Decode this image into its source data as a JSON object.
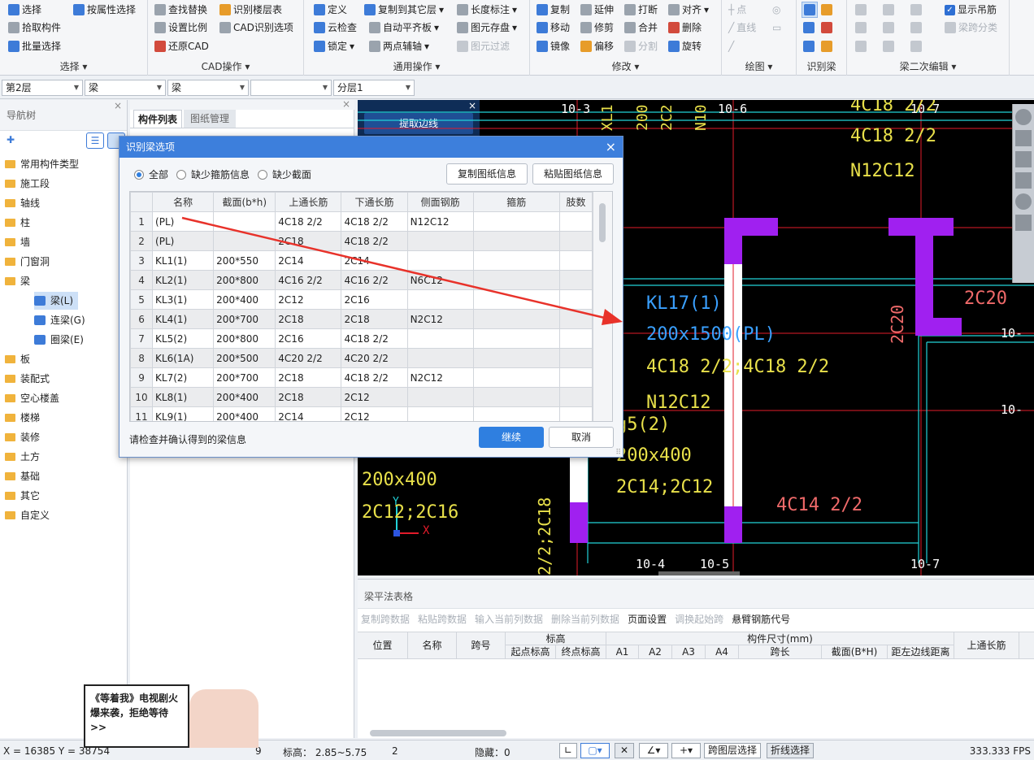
{
  "ribbon": {
    "select": {
      "title": "选择",
      "items": [
        "选择",
        "按属性选择",
        "拾取构件",
        "批量选择"
      ]
    },
    "cad": {
      "title": "CAD操作",
      "items": [
        "查找替换",
        "识别楼层表",
        "设置比例",
        "CAD识别选项",
        "还原CAD"
      ]
    },
    "common": {
      "title": "通用操作",
      "items": [
        "定义",
        "复制到其它层",
        "长度标注",
        "云检查",
        "自动平齐板",
        "图元存盘",
        "锁定",
        "两点辅轴",
        "图元过滤"
      ]
    },
    "modify": {
      "title": "修改",
      "items": [
        "复制",
        "延伸",
        "打断",
        "对齐",
        "移动",
        "修剪",
        "合并",
        "删除",
        "镜像",
        "偏移",
        "分割",
        "旋转"
      ]
    },
    "draw": {
      "title": "绘图",
      "items": [
        "点",
        "直线"
      ]
    },
    "recognize": {
      "title": "识别梁"
    },
    "beam2": {
      "title": "梁二次编辑",
      "show_hanger_label": "显示吊筋",
      "span_label": "梁跨分类"
    }
  },
  "combos": {
    "floor": "第2层",
    "type1": "梁",
    "type2": "梁",
    "empty": "",
    "layer": "分层1"
  },
  "nav": {
    "title": "导航树",
    "items": [
      "常用构件类型",
      "施工段",
      "轴线",
      "柱",
      "墙",
      "门窗洞",
      "梁",
      "板",
      "装配式",
      "空心楼盖",
      "楼梯",
      "装修",
      "土方",
      "基础",
      "其它",
      "自定义"
    ],
    "beam_children": [
      "梁(L)",
      "连梁(G)",
      "圈梁(E)"
    ]
  },
  "comp_panel": {
    "tab_list": "构件列表",
    "tab_drawing": "图纸管理",
    "side_title": "提取边线"
  },
  "dialog": {
    "title": "识别梁选项",
    "filters": [
      "全部",
      "缺少箍筋信息",
      "缺少截面"
    ],
    "copy_btn": "复制图纸信息",
    "paste_btn": "粘贴图纸信息",
    "columns": [
      "",
      "名称",
      "截面(b*h)",
      "上通长筋",
      "下通长筋",
      "侧面钢筋",
      "箍筋",
      "肢数"
    ],
    "rows": [
      [
        "1",
        "(PL)",
        "",
        "4C18 2/2",
        "4C18 2/2",
        "N12C12",
        "",
        ""
      ],
      [
        "2",
        "(PL)",
        "",
        "2C18",
        "4C18 2/2",
        "",
        "",
        ""
      ],
      [
        "3",
        "KL1(1)",
        "200*550",
        "2C14",
        "2C14",
        "",
        "",
        ""
      ],
      [
        "4",
        "KL2(1)",
        "200*800",
        "4C16 2/2",
        "4C16 2/2",
        "N6C12",
        "",
        ""
      ],
      [
        "5",
        "KL3(1)",
        "200*400",
        "2C12",
        "2C16",
        "",
        "",
        ""
      ],
      [
        "6",
        "KL4(1)",
        "200*700",
        "2C18",
        "2C18",
        "N2C12",
        "",
        ""
      ],
      [
        "7",
        "KL5(2)",
        "200*800",
        "2C16",
        "4C18 2/2",
        "",
        "",
        ""
      ],
      [
        "8",
        "KL6(1A)",
        "200*500",
        "4C20 2/2",
        "4C20 2/2",
        "",
        "",
        ""
      ],
      [
        "9",
        "KL7(2)",
        "200*700",
        "2C18",
        "4C18 2/2",
        "N2C12",
        "",
        ""
      ],
      [
        "10",
        "KL8(1)",
        "200*400",
        "2C18",
        "2C12",
        "",
        "",
        ""
      ],
      [
        "11",
        "KL9(1)",
        "200*400",
        "2C14",
        "2C12",
        "",
        "",
        ""
      ]
    ],
    "hint": "请检查并确认得到的梁信息",
    "continue": "继续",
    "cancel": "取消"
  },
  "cad": {
    "axis_labels": [
      "10-3",
      "10-6",
      "10-7",
      "10-4",
      "10-5",
      "10-7",
      "10-",
      "10-"
    ],
    "texts": [
      "4C18 2/2",
      "4C18 2/2",
      "N12C12",
      "KL17(1)",
      "200x1500(PL)",
      "4C18 2/2;4C18 2/2",
      "N12C12",
      "2C20",
      "2C20",
      "g5(2)",
      "200x400",
      "2C14;2C12",
      "200x400",
      "2C12;2C16",
      "4C14 2/2",
      "2/2;2C18",
      "XL1",
      "200",
      "2C2",
      "N10"
    ],
    "x_label": "X",
    "y_label": "Y"
  },
  "table_panel": {
    "title": "梁平法表格",
    "toolbar": [
      "复制跨数据",
      "粘贴跨数据",
      "输入当前列数据",
      "删除当前列数据",
      "页面设置",
      "调换起始跨",
      "悬臂钢筋代号"
    ],
    "headers": [
      "位置",
      "名称",
      "跨号",
      "标高",
      "起点标高",
      "终点标高",
      "构件尺寸(mm)",
      "A1",
      "A2",
      "A3",
      "A4",
      "跨长",
      "截面(B*H)",
      "距左边线距离",
      "上通长筋"
    ]
  },
  "ad": {
    "text": "《等着我》电视剧火爆来袭，拒绝等待>>"
  },
  "status": {
    "coords": "X = 16385 Y = 38754",
    "num": "9",
    "elev": "标高： 2.85~5.75",
    "count": "2",
    "hidden": "隐藏：0",
    "btn1": "跨图层选择",
    "btn2": "折线选择",
    "fps": "333.333 FPS"
  }
}
